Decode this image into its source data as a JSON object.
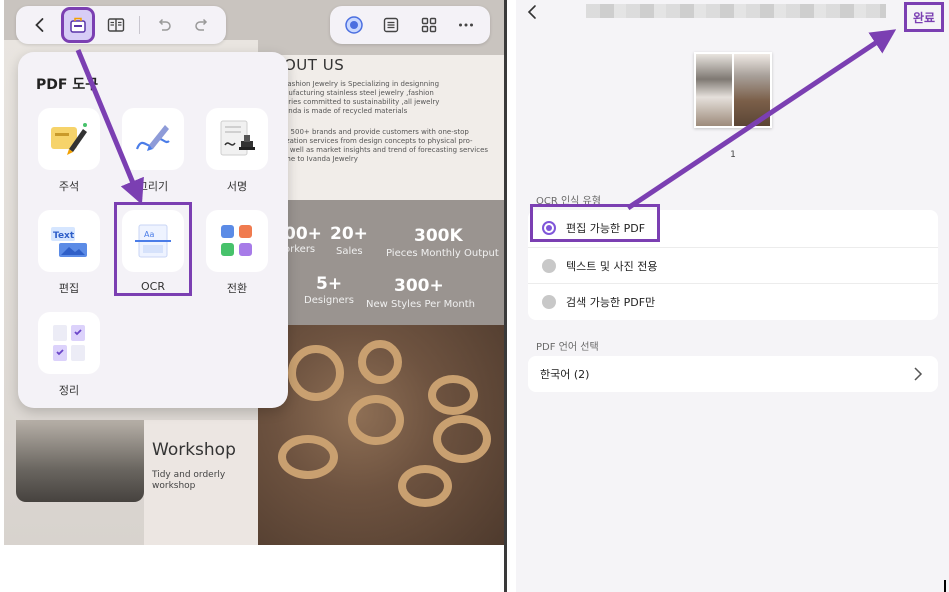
{
  "left": {
    "toolbar": {
      "left_icons": [
        "back-arrow-icon",
        "tools-icon",
        "reader-icon",
        "undo-icon",
        "redo-icon"
      ],
      "right_icons": [
        "ai-assistant-icon",
        "outline-list-icon",
        "grid-view-icon",
        "more-icon"
      ]
    },
    "popup": {
      "title": "PDF 도구",
      "tools": [
        {
          "label": "주석",
          "icon": "sticky-note-marker-icon"
        },
        {
          "label": "그리기",
          "icon": "pen-draw-icon"
        },
        {
          "label": "서명",
          "icon": "signature-stamp-icon"
        },
        {
          "label": "편집",
          "icon": "text-image-edit-icon"
        },
        {
          "label": "OCR",
          "icon": "ocr-scan-icon"
        },
        {
          "label": "전환",
          "icon": "convert-icon"
        },
        {
          "label": "정리",
          "icon": "organize-pages-icon"
        }
      ]
    },
    "document": {
      "heading": "OUT US",
      "para1": "Fashion Jewelry is Specializing in designning\nnufacturing stainless steel jewelry ,fashion\nories committed to sustainability ,all jewelry\nanda is made of recycled materials",
      "para2": "e 500+ brands and provide customers with one-stop\nization services from design concepts to physical pro-\ns well as market insights and trend of forecasting services\nme to Ivanda Jewelry",
      "stats": [
        {
          "num": "00+",
          "label": "orkers"
        },
        {
          "num": "20+",
          "label": "Sales"
        },
        {
          "num": "300K",
          "label": "Pieces Monthly Output"
        },
        {
          "num": "5+",
          "label": "Designers"
        },
        {
          "num": "300+",
          "label": "New Styles Per Month"
        }
      ],
      "workshop_title": "Workshop",
      "workshop_sub": "Tidy and orderly\nworkshop"
    }
  },
  "right": {
    "done_label": "완료",
    "page_number": "1",
    "ocr_section_label": "OCR 인식 유형",
    "options": [
      {
        "label": "편집 가능한 PDF",
        "selected": true
      },
      {
        "label": "텍스트 및 사진 전용",
        "selected": false
      },
      {
        "label": "검색 가능한 PDF만",
        "selected": false
      }
    ],
    "lang_section_label": "PDF 언어 선택",
    "lang_value": "한국어 (2)"
  },
  "colors": {
    "accent": "#7f56d9",
    "annotation": "#7b3fb2"
  }
}
